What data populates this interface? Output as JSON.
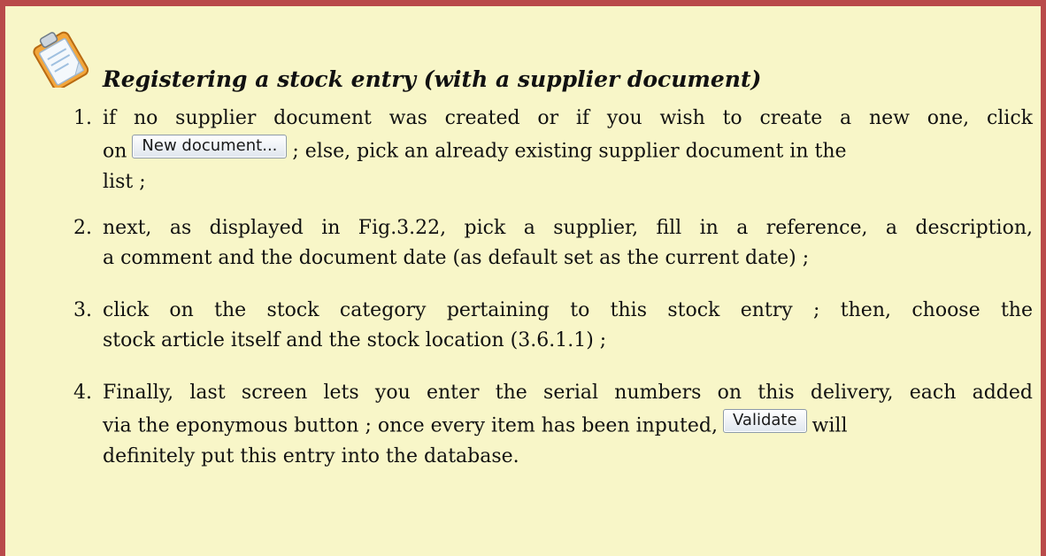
{
  "note": {
    "icon": "clipboard-note-icon",
    "title": "Registering a stock entry (with a supplier document)"
  },
  "colors": {
    "border": "#b94a4a",
    "background": "#f8f6c8"
  },
  "steps": [
    {
      "number": "1.",
      "line1": "if no supplier document was created or if you wish to create a new one, click",
      "line2_before": "on",
      "button_label": "New document...",
      "line2_after": "; else, pick an already existing supplier document in the",
      "line3": "list ;"
    },
    {
      "number": "2.",
      "line1": "next, as displayed in Fig.3.22, pick a supplier, fill in a reference, a description,",
      "line2": "a comment and the document date (as default set as the current date) ;"
    },
    {
      "number": "3.",
      "line1": "click on the stock category pertaining to this stock entry ; then, choose the",
      "line2": "stock article itself and the stock location (3.6.1.1) ;"
    },
    {
      "number": "4.",
      "line1": "Finally, last screen lets you enter the serial numbers on this delivery, each added",
      "line2_before": "via the eponymous button ; once every item has been inputed,",
      "button_label": "Validate",
      "line2_after": "will",
      "line3": "definitely put this entry into the database."
    }
  ]
}
